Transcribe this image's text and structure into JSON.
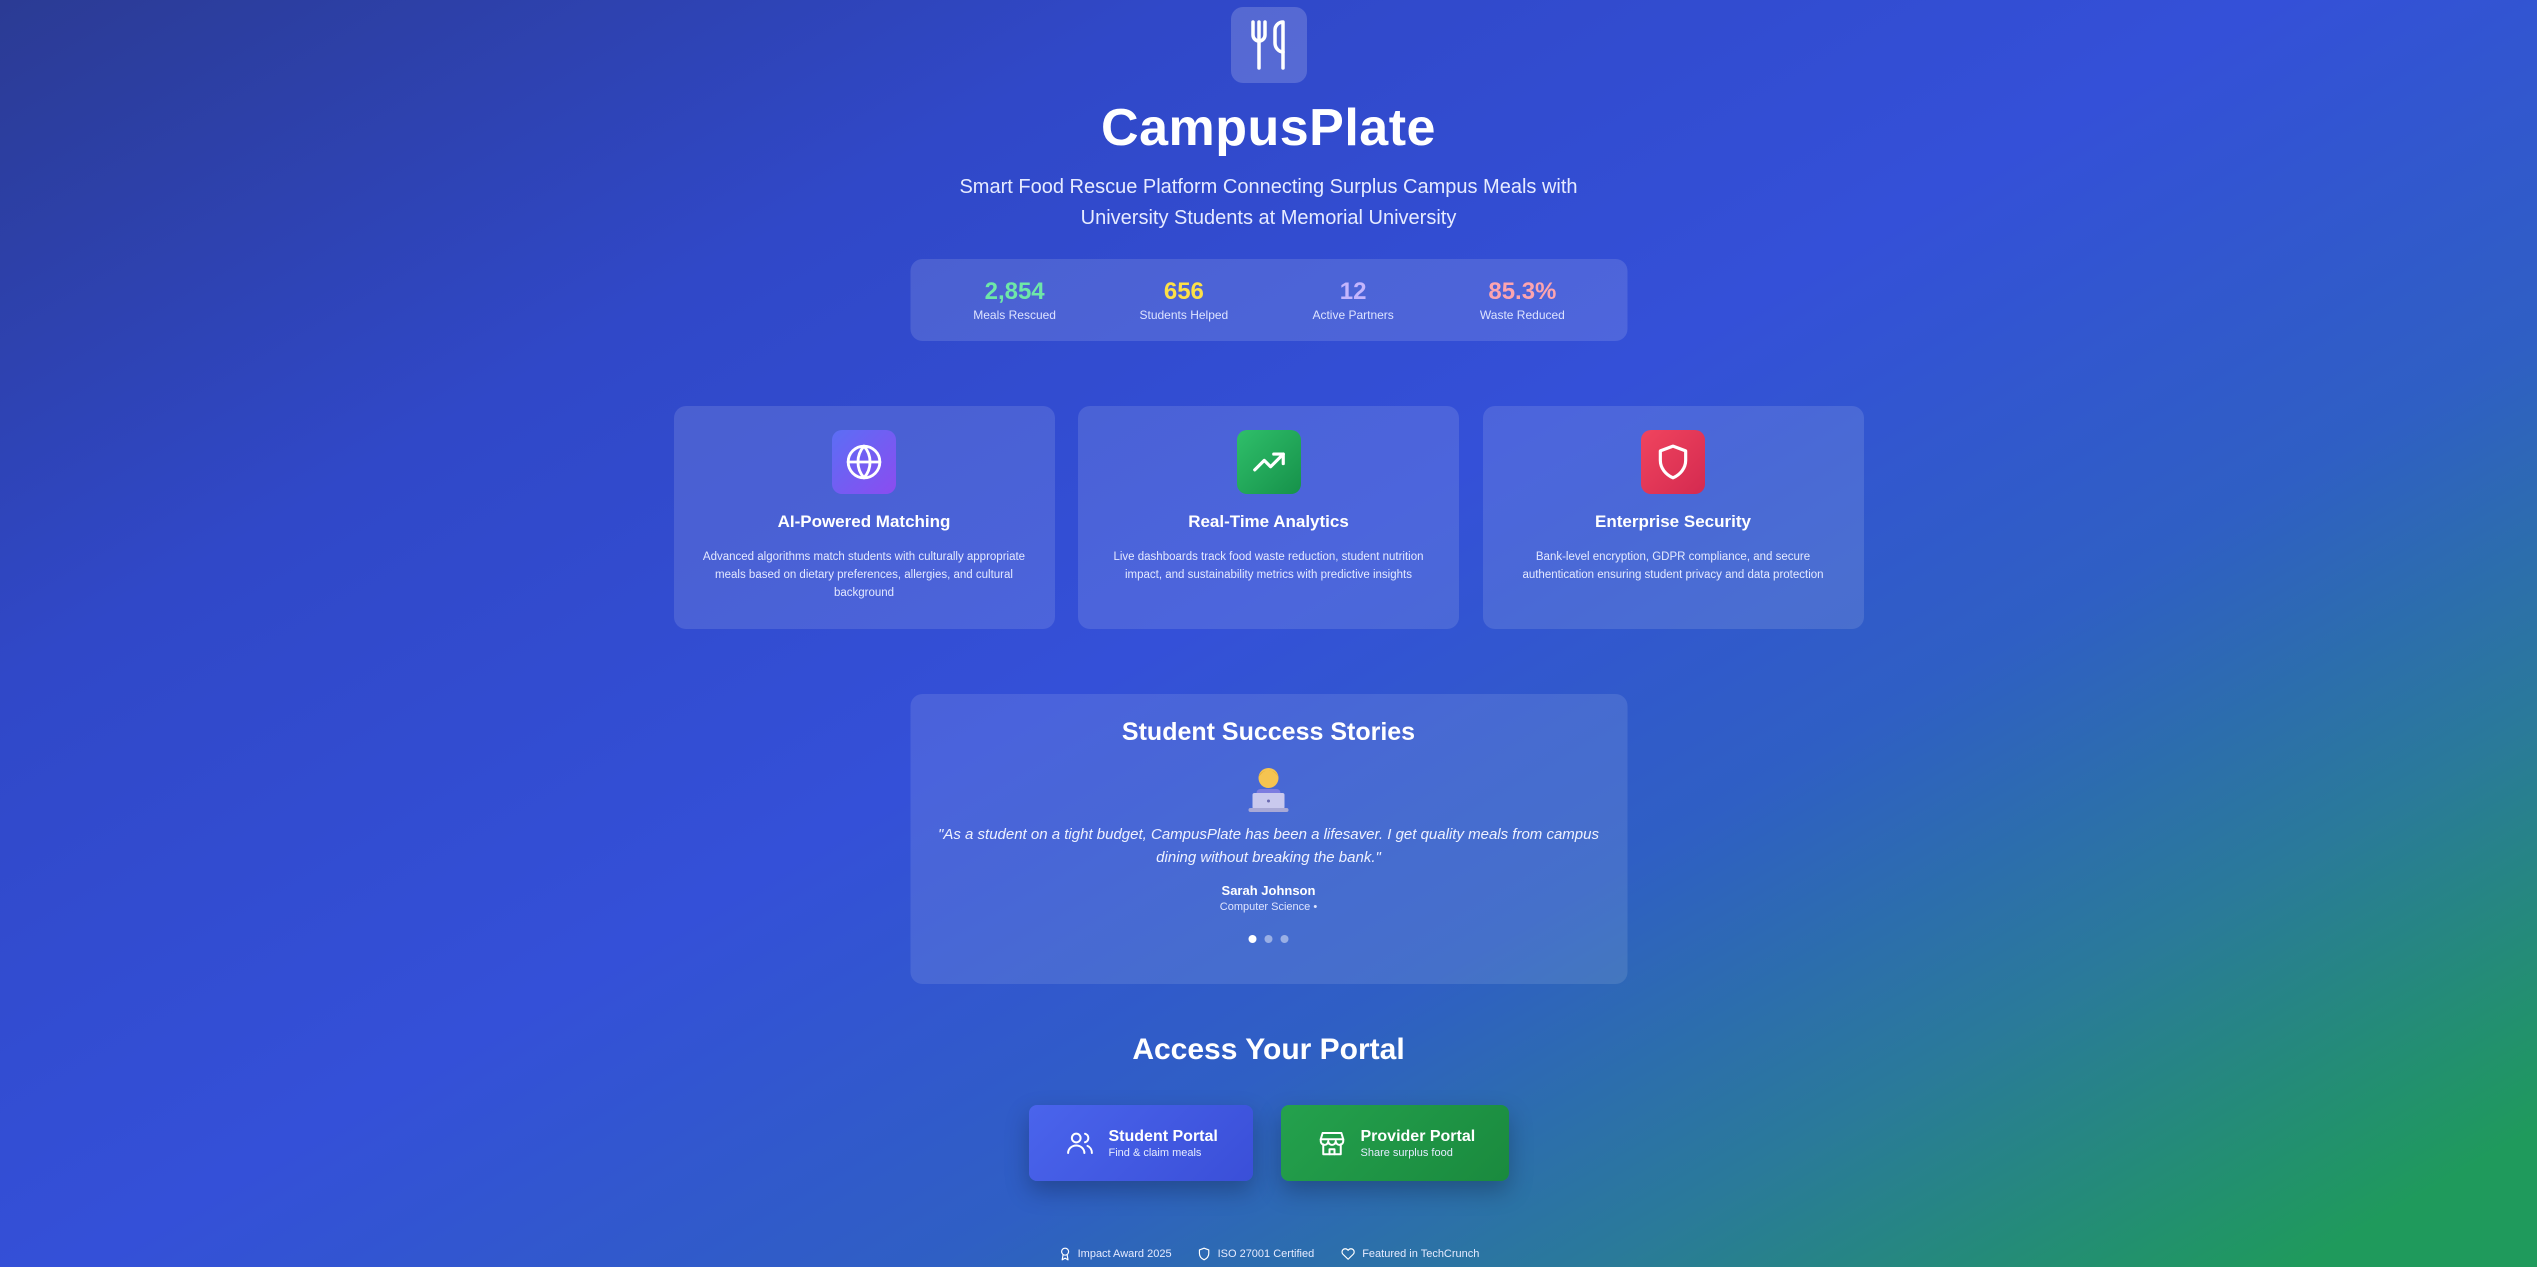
{
  "brand": {
    "name": "CampusPlate",
    "tagline": "Smart Food Rescue Platform Connecting Surplus Campus Meals with University Students at Memorial University",
    "logo_icon": "fork-knife-icon"
  },
  "stats": [
    {
      "value": "2,854",
      "label": "Meals Rescued",
      "color": "#6ee7a8"
    },
    {
      "value": "656",
      "label": "Students Helped",
      "color": "#fde047"
    },
    {
      "value": "12",
      "label": "Active Partners",
      "color": "#c4b5fd"
    },
    {
      "value": "85.3%",
      "label": "Waste Reduced",
      "color": "#fda4af"
    }
  ],
  "features": [
    {
      "title": "AI-Powered Matching",
      "description": "Advanced algorithms match students with culturally appropriate meals based on dietary preferences, allergies, and cultural background",
      "icon": "globe-icon",
      "color": "#7c5cf2"
    },
    {
      "title": "Real-Time Analytics",
      "description": "Live dashboards track food waste reduction, student nutrition impact, and sustainability metrics with predictive insights",
      "icon": "trending-up-icon",
      "color": "#22a95a"
    },
    {
      "title": "Enterprise Security",
      "description": "Bank-level encryption, GDPR compliance, and secure authentication ensuring student privacy and data protection",
      "icon": "shield-icon",
      "color": "#e5354f"
    }
  ],
  "stories": {
    "title": "Student Success Stories",
    "avatar_icon": "student-laptop-icon",
    "quote": "\"As a student on a tight budget, CampusPlate has been a lifesaver. I get quality meals from campus dining without breaking the bank.\"",
    "author": "Sarah Johnson",
    "role": "Computer Science •",
    "pages": 3,
    "active_page": 1
  },
  "portals": {
    "title": "Access Your Portal",
    "student": {
      "label": "Student Portal",
      "sub": "Find & claim meals",
      "icon": "users-icon"
    },
    "provider": {
      "label": "Provider Portal",
      "sub": "Share surplus food",
      "icon": "store-icon"
    }
  },
  "badges": [
    {
      "label": "Impact Award 2025",
      "icon": "award-icon"
    },
    {
      "label": "ISO 27001 Certified",
      "icon": "shield-icon"
    },
    {
      "label": "Featured in TechCrunch",
      "icon": "heart-icon"
    }
  ]
}
